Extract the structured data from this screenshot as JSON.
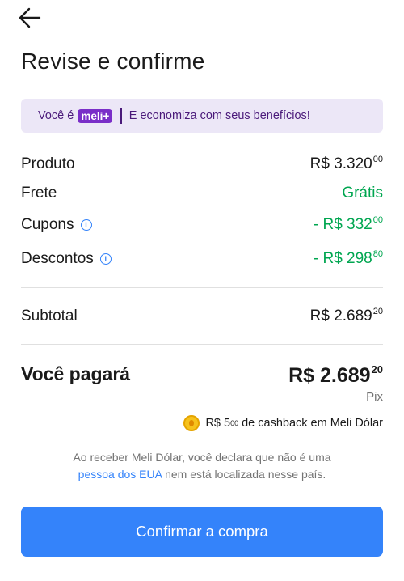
{
  "header": {
    "back_icon": "arrow-left-icon",
    "title": "Revise e confirme"
  },
  "banner": {
    "prefix": "Você é",
    "badge": "meli+",
    "text": "E economiza com seus benefícios!",
    "colors": {
      "background": "#ece7f7",
      "text": "#4a1a7a",
      "badge": "#7a2ec8"
    }
  },
  "summary": {
    "produto": {
      "label": "Produto",
      "value": "R$ 3.320",
      "cents": "00"
    },
    "frete": {
      "label": "Frete",
      "value": "Grátis"
    },
    "cupons": {
      "label": "Cupons",
      "value": "- R$ 332",
      "cents": "00"
    },
    "descontos": {
      "label": "Descontos",
      "value": "- R$ 298",
      "cents": "80"
    },
    "subtotal": {
      "label": "Subtotal",
      "value": "R$ 2.689",
      "cents": "20"
    }
  },
  "total": {
    "label": "Você pagará",
    "value": "R$ 2.689",
    "cents": "20",
    "method": "Pix"
  },
  "cashback": {
    "amount": "R$ 5",
    "cents": "00",
    "text": "de cashback em Meli Dólar"
  },
  "disclaimer": {
    "line1": "Ao receber Meli Dólar, você declara que não é uma",
    "link": "pessoa dos EUA",
    "line2": "nem está localizada nesse país."
  },
  "confirm_button": "Confirmar a compra",
  "colors": {
    "accent": "#3483fa",
    "green": "#00a650",
    "muted": "#737373"
  }
}
